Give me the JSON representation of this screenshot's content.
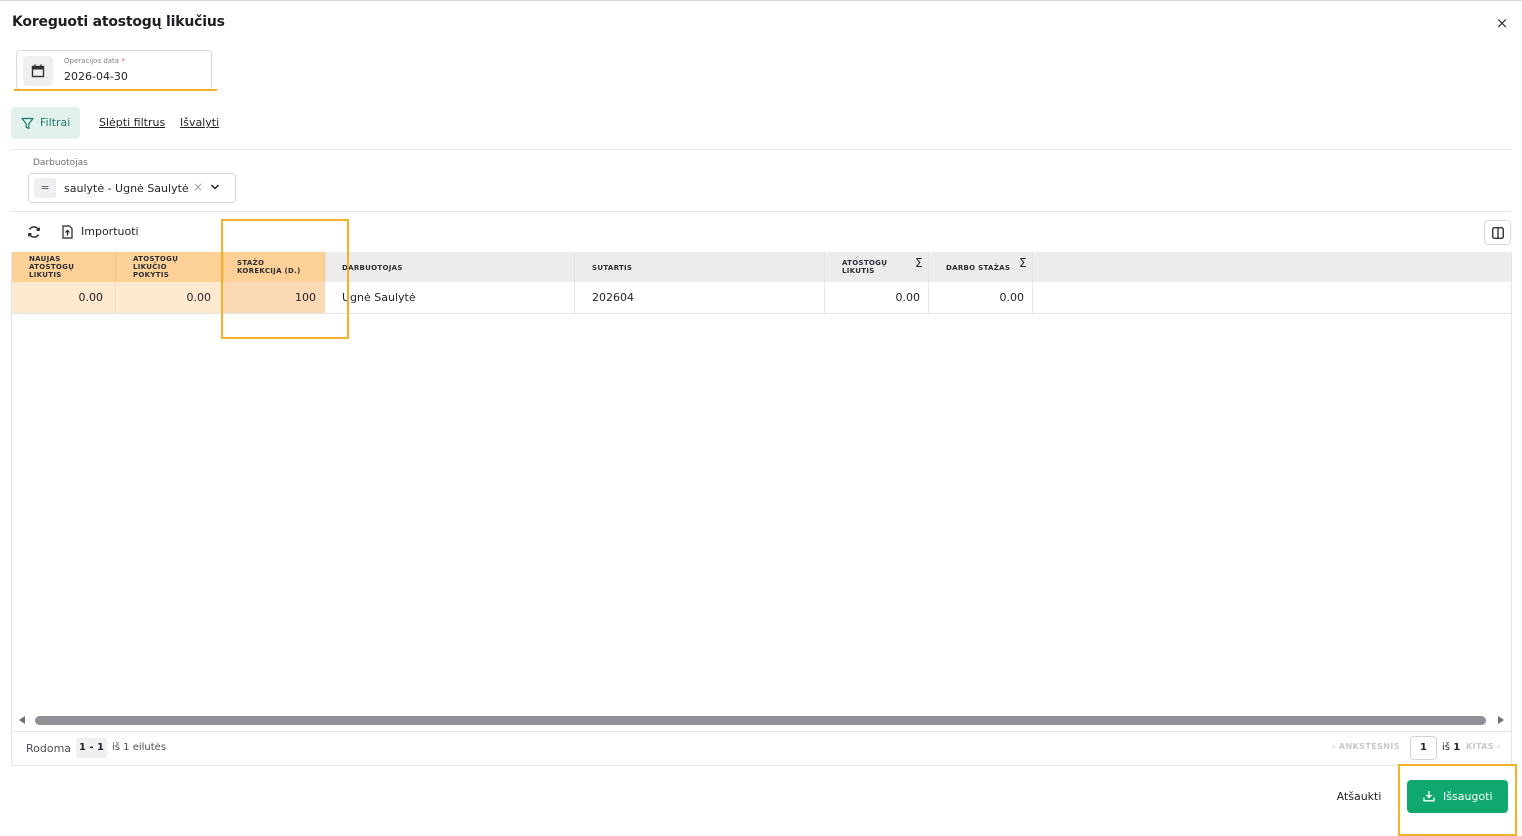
{
  "dialog": {
    "title": "Koreguoti atostogų likučius",
    "close_icon": "×"
  },
  "date_field": {
    "label": "Operacijos data",
    "required_mark": "*",
    "value": "2026-04-30",
    "icon": "calendar-icon"
  },
  "filters": {
    "button_label": "Filtrai",
    "hide_label": "Slėpti filtrus",
    "clear_label": "Išvalyti"
  },
  "employee_filter": {
    "label": "Darbuotojas",
    "operator": "=",
    "value": "saulytė - Ugnė Saulytė",
    "clear_icon": "×"
  },
  "toolbar": {
    "import_label": "Importuoti"
  },
  "grid": {
    "columns": [
      {
        "label": "NAUJAS\nATOSTOGŲ\nLIKUTIS"
      },
      {
        "label": "ATOSTOGŲ\nLIKUČIO\nPOKYTIS"
      },
      {
        "label": "STAŽO\nKOREKCIJA (D.)"
      },
      {
        "label": "DARBUOTOJAS"
      },
      {
        "label": "SUTARTIS"
      },
      {
        "label": "ATOSTOGŲ\nLIKUTIS",
        "sigma": "Σ"
      },
      {
        "label": "DARBO STAŽAS",
        "sigma": "Σ"
      }
    ],
    "rows": [
      [
        "0.00",
        "0.00",
        "100",
        "Ugnė Saulytė",
        "202604",
        "0.00",
        "0.00"
      ]
    ]
  },
  "pagination": {
    "showing_label": "Rodoma",
    "range": "1 - 1",
    "of_rows": "iš 1 eilutės",
    "prev_label": "ANKSTESNIS",
    "page": "1",
    "of_pages_prefix": "iš",
    "total_pages": "1",
    "next_label": "KITAS"
  },
  "actions": {
    "cancel_label": "Atšaukti",
    "save_label": "Išsaugoti"
  },
  "colors": {
    "accent_green": "#0fa970",
    "highlight_orange": "#f2b128",
    "editable_header": "#fdd098",
    "editable_cell": "#fde8d0"
  }
}
